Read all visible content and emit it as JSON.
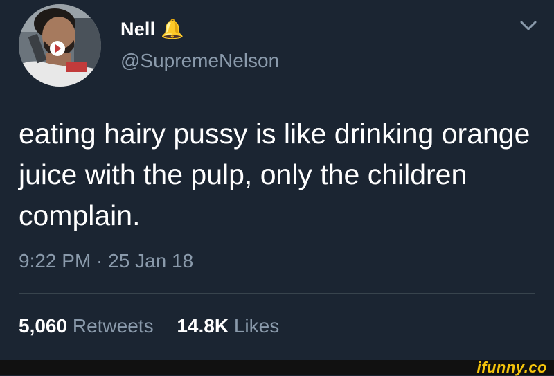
{
  "author": {
    "display_name": "Nell 🔔",
    "handle": "@SupremeNelson",
    "avatar_icon": "profile-photo"
  },
  "menu_icon": "chevron-down-icon",
  "tweet": {
    "text": "eating hairy pussy is like drinking orange juice with the pulp, only the children complain.",
    "timestamp": "9:22 PM · 25 Jan 18"
  },
  "stats": {
    "retweets": {
      "count": "5,060",
      "label": "Retweets"
    },
    "likes": {
      "count": "14.8K",
      "label": "Likes"
    }
  },
  "watermark": "ifunny.co",
  "colors": {
    "background": "#1b2532",
    "primary_text": "#ffffff",
    "secondary_text": "#8a9aab",
    "divider": "#38444d",
    "watermark": "#f5c40c"
  }
}
